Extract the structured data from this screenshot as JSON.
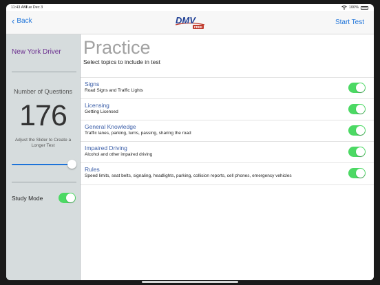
{
  "status_bar": {
    "time": "11:43 AM",
    "date": "Tue Dec 3",
    "battery": "100%"
  },
  "nav": {
    "back_label": "Back",
    "logo_text": "DMV",
    "logo_badge": "FREE",
    "start_test_label": "Start Test"
  },
  "sidebar": {
    "state_name": "New York Driver",
    "questions_label": "Number of Questions",
    "questions_count": "176",
    "slider_hint": "Adjust the Slider to Create a Longer Test",
    "slider_fraction": 1.0,
    "study_mode_label": "Study Mode",
    "study_mode_on": true
  },
  "main": {
    "title": "Practice",
    "subtitle": "Select topics to include in test",
    "topics": [
      {
        "title": "Signs",
        "desc": "Road Signs and Traffic Lights",
        "enabled": true
      },
      {
        "title": "Licensing",
        "desc": "Getting Licensed",
        "enabled": true
      },
      {
        "title": "General Knowledge",
        "desc": "Traffic lanes, parking, turns, passing, sharing the road",
        "enabled": true
      },
      {
        "title": "Impaired Driving",
        "desc": "Alcohol and other impaired driving",
        "enabled": true
      },
      {
        "title": "Rules",
        "desc": "Speed limits, seat belts, signaling, headlights, parking, collision reports, cell phones, emergency vehicles",
        "enabled": true
      }
    ]
  },
  "colors": {
    "accent": "#1d73d9",
    "toggle_on": "#4cd964",
    "state_name": "#6b2f8f",
    "topic_title": "#3b5ea8",
    "sidebar_bg": "#d6dcdd"
  }
}
